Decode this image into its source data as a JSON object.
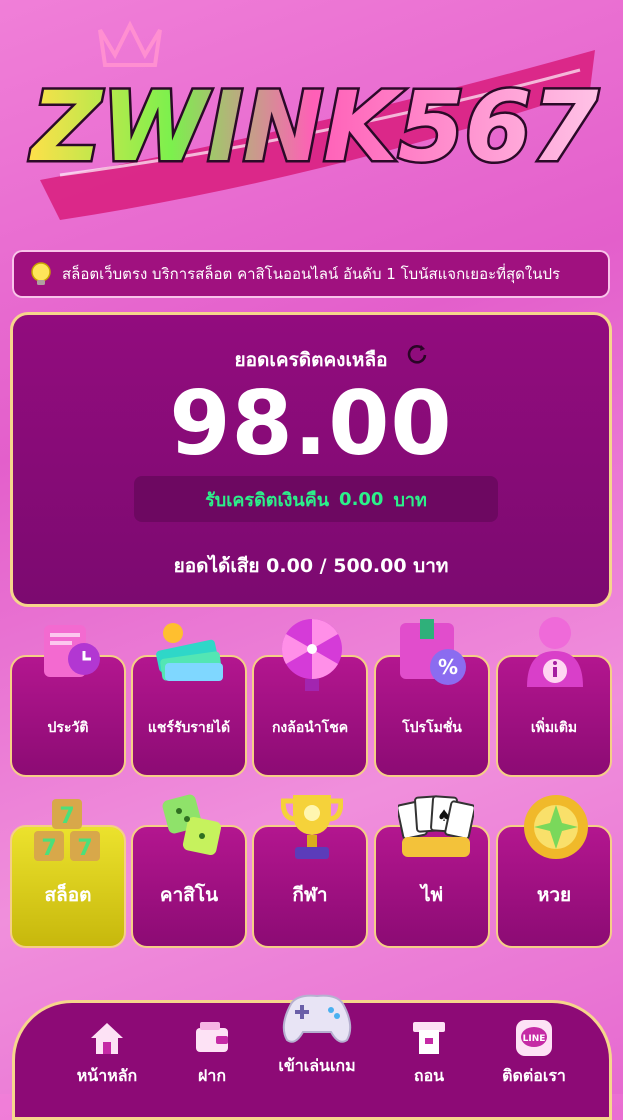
{
  "brand": {
    "logo_text": "ZWINK567",
    "logo_alt": "ZWINK567 logo"
  },
  "announcement": {
    "text": "สล็อตเว็บตรง บริการสล็อต คาสิโนออนไลน์ อันดับ 1 โบนัสแจกเยอะที่สุดในปร"
  },
  "balance": {
    "title": "ยอดเครดิตคงเหลือ",
    "amount": "98.00",
    "cashback_label": "รับเครดิตเงินคืน",
    "cashback_value": "0.00",
    "cashback_unit": "บาท",
    "winloss": "ยอดได้เสีย 0.00 / 500.00 บาท"
  },
  "menu": [
    {
      "label": "ประวัติ",
      "icon": "history-icon"
    },
    {
      "label": "แชร์รับรายได้",
      "icon": "money-stack-icon"
    },
    {
      "label": "กงล้อนำโชค",
      "icon": "lucky-wheel-icon"
    },
    {
      "label": "โปรโมชั่น",
      "icon": "promotion-icon"
    },
    {
      "label": "เพิ่มเติม",
      "icon": "user-info-icon"
    }
  ],
  "categories": [
    {
      "label": "สล็อต",
      "icon": "slot-777-icon",
      "active": true
    },
    {
      "label": "คาสิโน",
      "icon": "dice-icon",
      "active": false
    },
    {
      "label": "กีฬา",
      "icon": "trophy-icon",
      "active": false
    },
    {
      "label": "ไพ่",
      "icon": "cards-icon",
      "active": false
    },
    {
      "label": "หวย",
      "icon": "lottery-ball-icon",
      "active": false
    }
  ],
  "nav": [
    {
      "label": "หน้าหลัก",
      "icon": "home-icon"
    },
    {
      "label": "ฝาก",
      "icon": "wallet-icon"
    },
    {
      "label": "เข้าเล่นเกม",
      "icon": "gamepad-icon"
    },
    {
      "label": "ถอน",
      "icon": "withdraw-icon"
    },
    {
      "label": "ติดต่อเรา",
      "icon": "line-icon"
    }
  ],
  "colors": {
    "background": "#e35fcb",
    "card": "#8a0b78",
    "border": "#f6d68c",
    "cashback_green": "#2cf08a",
    "active_tile": "#ece22d"
  }
}
